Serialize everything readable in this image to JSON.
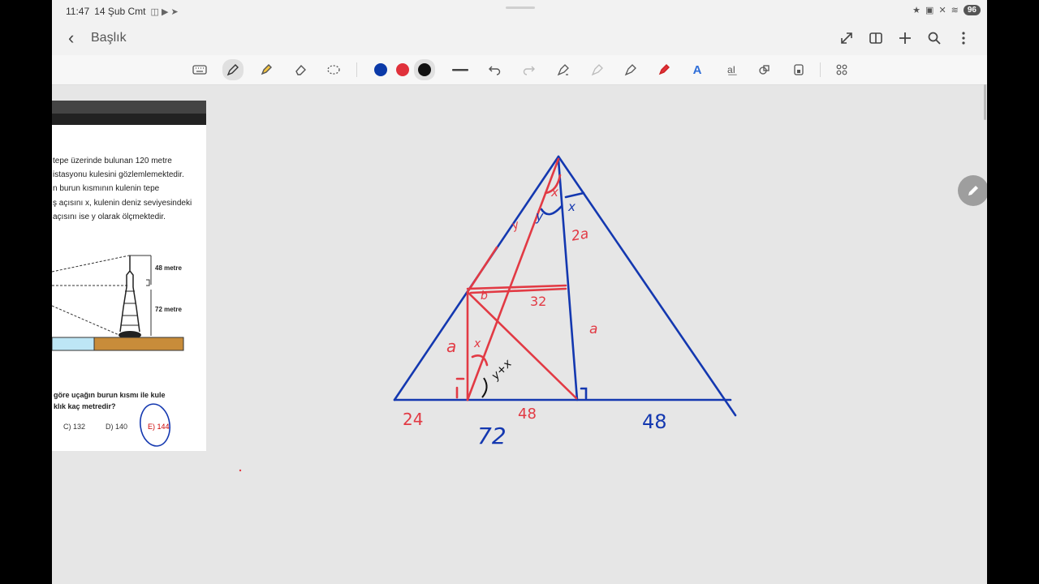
{
  "status": {
    "time": "11:47",
    "date": "14 Şub Cmt",
    "battery": "96"
  },
  "header": {
    "title": "Başlık"
  },
  "colors": {
    "blue": "#0b3aa8",
    "red": "#e0313b",
    "black": "#111111",
    "ink_blue": "#1438b0",
    "ink_red": "#e23a44"
  },
  "toolbar": {
    "tools": [
      "keyboard-icon",
      "pen-icon",
      "highlighter-icon",
      "eraser-icon",
      "lasso-icon",
      "color-blue",
      "color-red",
      "color-black",
      "stroke-width-icon",
      "undo-icon",
      "redo-icon",
      "shape-pen-icon",
      "shape-fill-icon",
      "shape-arrow-icon",
      "laser-pen-icon",
      "text-style-icon",
      "text-box-icon",
      "stickers-icon",
      "lock-icon",
      "more-tools-icon"
    ]
  },
  "doc": {
    "lines": [
      "tepe üzerinde bulunan 120 metre",
      "istasyonu kulesini gözlemlemektedir.",
      "n burun kısmının kulenin tepe",
      "ş açısını x, kulenin deniz seviyesindeki",
      "açısını ise y olarak ölçmektedir."
    ],
    "label_48": "48 metre",
    "label_72": "72 metre",
    "question_line1": "göre uçağın burun kısmı ile kule",
    "question_line2": "klık kaç metredir?",
    "options": [
      "C) 132",
      "D) 140",
      "E) 144"
    ]
  },
  "handwriting": {
    "red": [
      "24",
      "48",
      "32",
      "a",
      "2a",
      "x",
      "y",
      "y",
      "b",
      "x",
      "y+x"
    ],
    "blue": [
      "72",
      "48",
      "x",
      "y",
      "a",
      "2a"
    ]
  }
}
